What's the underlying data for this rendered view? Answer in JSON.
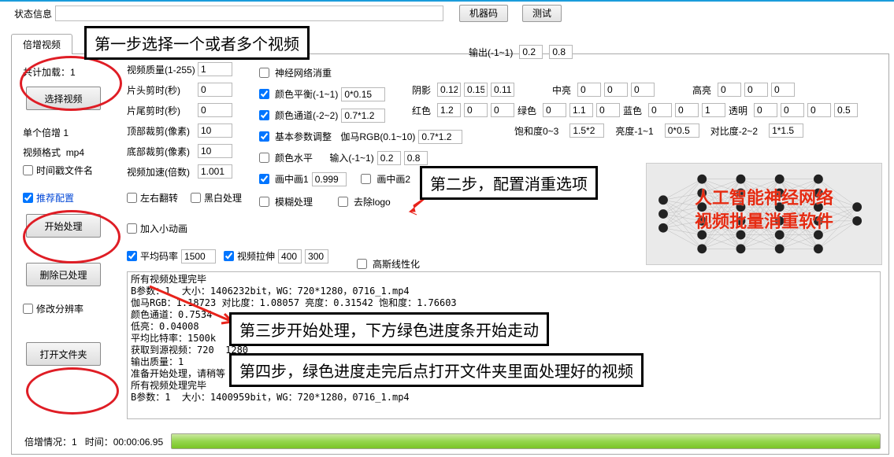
{
  "top": {
    "status_label": "状态信息",
    "status_value": "",
    "machine_code_btn": "机器码",
    "test_btn": "测试"
  },
  "tab": {
    "label": "倍增视频"
  },
  "left": {
    "loaded_label": "共计加载：",
    "loaded_value": "1",
    "select_video_btn": "选择视频",
    "single_multiplier_label": "单个倍增",
    "single_multiplier_value": "1",
    "video_format_label": "视频格式",
    "video_format_value": "mp4",
    "timestamp_filename": "时间戳文件名",
    "recommend_config": "推荐配置",
    "start_process_btn": "开始处理",
    "delete_processed_btn": "删除已处理",
    "modify_resolution": "修改分辨率",
    "open_folder_btn": "打开文件夹"
  },
  "params": {
    "video_quality_label": "视频质量(1-255)",
    "video_quality": "1",
    "head_trim_label": "片头剪时(秒)",
    "head_trim": "0",
    "tail_trim_label": "片尾剪时(秒)",
    "tail_trim": "0",
    "top_crop_label": "顶部裁剪(像素)",
    "top_crop": "10",
    "bottom_crop_label": "底部裁剪(像素)",
    "bottom_crop": "10",
    "speed_label": "视频加速(倍数)",
    "speed": "1.001",
    "hflip": "左右翻转",
    "bw": "黑白处理",
    "blur": "模糊处理",
    "delogo": "去除logo",
    "add_anim": "加入小动画",
    "avg_bitrate_label": "平均码率",
    "avg_bitrate": "1500",
    "stretch_label": "视频拉伸",
    "stretch_w": "400",
    "stretch_h": "300"
  },
  "opts": {
    "nn_dedup": "神经网络消重",
    "color_bal_label": "颜色平衡(-1~1)",
    "color_bal_val": "0*0.15",
    "color_ch_label": "颜色通道(-2~2)",
    "color_ch_val": "0.7*1.2",
    "basic_adj": "基本参数调整",
    "gamma_label": "伽马RGB(0.1~10)",
    "gamma_val": "0.7*1.2",
    "color_level": "颜色水平",
    "in_label": "输入(-1~1)",
    "in_a": "0.2",
    "in_b": "0.8",
    "out_label": "输出(-1~1)",
    "out_a": "0.2",
    "out_b": "0.8",
    "pip1_label": "画中画1",
    "pip1_val": "0.999",
    "pip2_label": "画中画2",
    "gauss": "高斯线性化"
  },
  "far": {
    "shadow_label": "阴影",
    "shadow": [
      "0.12",
      "0.15",
      "0.11"
    ],
    "mid_label": "中亮",
    "mid": [
      "0",
      "0",
      "0"
    ],
    "hi_label": "高亮",
    "hi": [
      "0",
      "0",
      "0"
    ],
    "r_label": "红色",
    "r": [
      "1.2",
      "0",
      "0"
    ],
    "g_label": "绿色",
    "g": [
      "0",
      "1.1",
      "0"
    ],
    "b_label": "蓝色",
    "b": [
      "0",
      "0",
      "1"
    ],
    "a_label": "透明",
    "a": [
      "0",
      "0",
      "0",
      "0.5"
    ],
    "sat_label": "饱和度0~3",
    "sat": "1.5*2",
    "bright_label": "亮度-1~1",
    "bright": "0*0.5",
    "contrast_label": "对比度-2~2",
    "contrast": "1*1.5"
  },
  "nn_title_a": "人工智能神经网络",
  "nn_title_b": "视频批量消重软件",
  "log": "所有视频处理完毕\nB参数：1  大小：1406232bit，WG：720*1280，0716_1.mp4\n伽马RGB：1.18723 对比度：1.08057 亮度：0.31542 饱和度：1.76603\n颜色通道：0.7534\n低亮：0.04008\n平均比特率：1500k\n获取到源视频：720  1280\n输出质量：1\n准备开始处理，请稍等\n所有视频处理完毕\nB参数：1  大小：1400959bit，WG：720*1280，0716_1.mp4",
  "status": {
    "mult_label": "倍增情况：",
    "mult_value": "1",
    "time_label": "时间：",
    "time_value": "00:00:06.95"
  },
  "anno": {
    "step1": "第一步选择一个或者多个视频",
    "step2": "第二步，配置消重选项",
    "step3": "第三步开始处理，下方绿色进度条开始走动",
    "step4": "第四步，绿色进度走完后点打开文件夹里面处理好的视频"
  }
}
